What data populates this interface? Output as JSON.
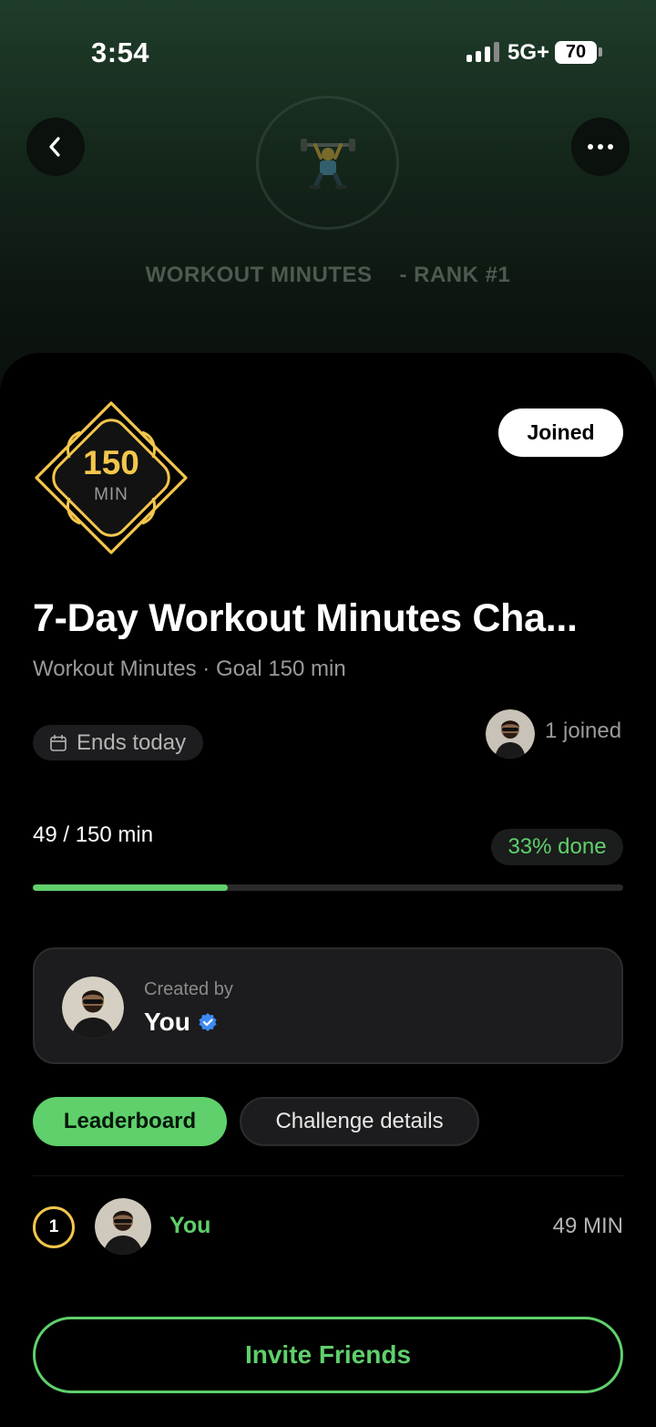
{
  "status_bar": {
    "time": "3:54",
    "network": "5G+",
    "battery": "70"
  },
  "header": {
    "back_icon": "chevron-left-icon",
    "more_icon": "ellipsis-icon",
    "emblem_icon": "weightlifter-icon",
    "category": "WORKOUT MINUTES",
    "rank": "- RANK #1"
  },
  "badge": {
    "value": "150",
    "unit": "MIN",
    "color": "#f3c64c"
  },
  "joined_button": "Joined",
  "challenge": {
    "title": "7-Day Workout Minutes Cha...",
    "meta": "Workout Minutes · Goal 150 min",
    "ends": "Ends today",
    "joined_count": "1 joined"
  },
  "progress": {
    "text": "49 / 150 min",
    "done_label": "33% done",
    "fraction": 0.33,
    "accent": "#5fd06b"
  },
  "creator": {
    "label": "Created by",
    "name": "You",
    "verified_icon": "verified-badge-icon"
  },
  "tabs": [
    {
      "label": "Leaderboard",
      "active": true
    },
    {
      "label": "Challenge details",
      "active": false
    }
  ],
  "leaderboard": [
    {
      "rank": "1",
      "name": "You",
      "score": "49 MIN"
    }
  ],
  "invite_button": "Invite Friends"
}
